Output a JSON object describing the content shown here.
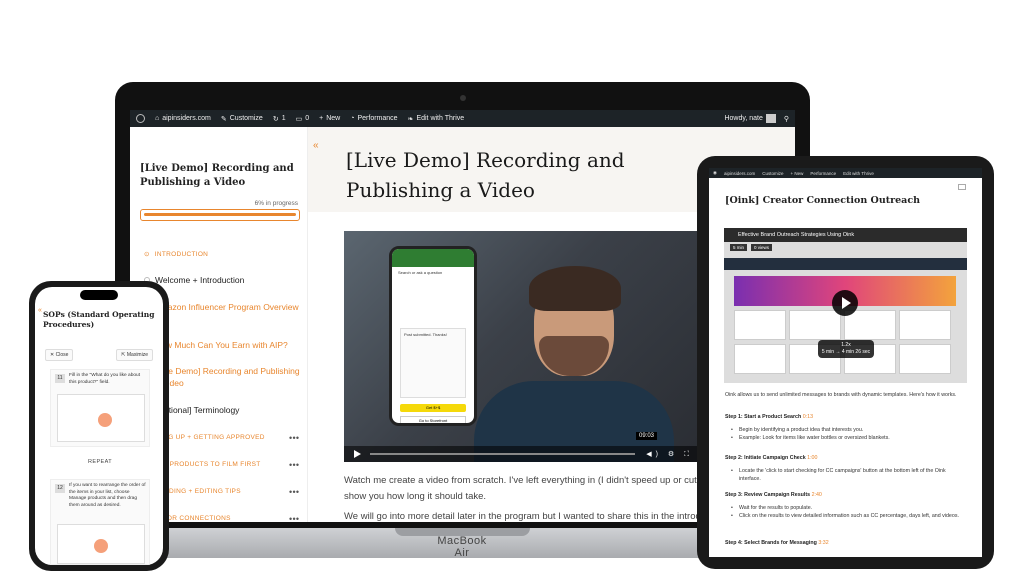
{
  "laptop": {
    "brand": "MacBook Air",
    "wpbar": {
      "site": "aipinsiders.com",
      "customize": "Customize",
      "updates": "1",
      "comments": "0",
      "new": "New",
      "performance": "Performance",
      "thrive": "Edit with Thrive",
      "howdy": "Howdy, nate"
    },
    "sidebar": {
      "course_title": "[Live Demo] Recording and Publishing a Video",
      "progress_text": "6% in progress",
      "progress_pct": 6,
      "section_intro": "INTRODUCTION",
      "lessons": [
        "Welcome + Introduction",
        "Amazon Influencer Program Overview",
        "How Much Can You Earn with AIP?",
        "[Live Demo] Recording and Publishing a Video",
        "[Optional] Terminology"
      ],
      "sections": [
        "SIGNING UP + GETTING APPROVED",
        "WHICH PRODUCTS TO FILM FIRST",
        "RECORDING + EDITING TIPS",
        "CREATOR CONNECTIONS"
      ]
    },
    "lesson_title": "[Live Demo] Recording and Publishing a Video",
    "video": {
      "time": "09:03",
      "phone_search": "Search or ask a question",
      "phone_card_title": "Post submitted. Thanks!",
      "phone_btn1": "Get $+$",
      "phone_btn2": "Go to Storefront"
    },
    "paragraphs": [
      "Watch me create a video from scratch. I've left everything in (I didn't speed up or cut out the process) to show you how long it should take.",
      "We will go into more detail later in the program but I wanted to share this in the introdu"
    ]
  },
  "tablet": {
    "wpbar": {
      "site": "aipinsiders.com",
      "customize": "Customize",
      "new": "New",
      "performance": "Performance",
      "thrive": "Edit with Thrive"
    },
    "title": "[Oink] Creator Connection Outreach",
    "video": {
      "title": "Effective Brand Outreach Strategies Using Oink",
      "duration": "5 min",
      "views": "0 views",
      "speed": "1.2x",
      "time_pill": "5 min → 4 min 26 sec"
    },
    "intro": "Oink allows us to send unlimited messages to brands with dynamic templates. Here's how it works.",
    "steps": [
      {
        "label": "Step 1: Start a Product Search",
        "time": "0:13",
        "bullets": [
          "Begin by identifying a product idea that interests you.",
          "Example: Look for items like water bottles or oversized blankets."
        ]
      },
      {
        "label": "Step 2: Initiate Campaign Check",
        "time": "1:00",
        "bullets": [
          "Locate the 'click to start checking for CC campaigns' button at the bottom left of the Oink interface."
        ]
      },
      {
        "label": "Step 3: Review Campaign Results",
        "time": "2:40",
        "bullets": [
          "Wait for the results to populate.",
          "Click on the results to view detailed information such as CC percentage, days left, and videos."
        ]
      },
      {
        "label": "Step 4: Select Brands for Messaging",
        "time": "3:32",
        "bullets": []
      }
    ]
  },
  "phone": {
    "title": "SOPs (Standard Operating Procedures)",
    "close": "Close",
    "maximize": "Maximize",
    "step11_num": "11",
    "step11_text": "Fill in the \"What do you like about this product?\" field.",
    "repeat": "REPEAT",
    "step12_num": "12",
    "step12_text": "If you want to rearrange the order of the items in your list, choose Manage products and then drag them around as desired."
  },
  "colors": {
    "accent": "#e8862e",
    "wp_bar": "#1d2327"
  }
}
